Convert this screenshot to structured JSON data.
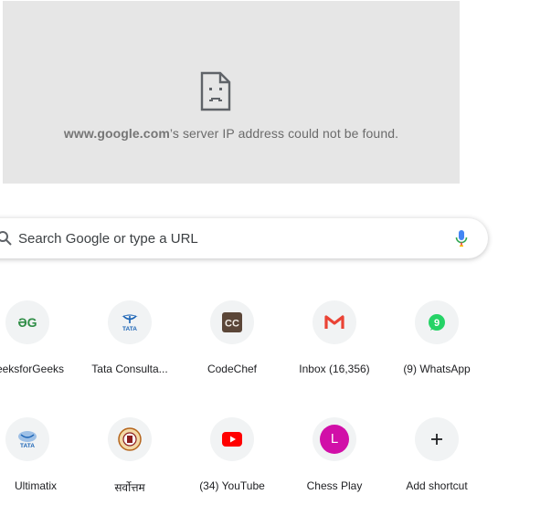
{
  "error": {
    "host": "www.google.com",
    "message": "’s server IP address could not be found."
  },
  "search": {
    "placeholder": "Search Google or type a URL"
  },
  "shortcuts": [
    {
      "label": "eeksforGeeks",
      "icon": "geeksforgeeks-icon"
    },
    {
      "label": "Tata Consulta...",
      "icon": "tata-icon"
    },
    {
      "label": "CodeChef",
      "icon": "codechef-icon"
    },
    {
      "label": "Inbox (16,356)",
      "icon": "gmail-icon"
    },
    {
      "label": "(9) WhatsApp",
      "icon": "whatsapp-icon"
    },
    {
      "label": "Ultimatix",
      "icon": "tata-icon"
    },
    {
      "label": "सर्वोत्तम",
      "icon": "emblem-icon"
    },
    {
      "label": "(34) YouTube",
      "icon": "youtube-icon"
    },
    {
      "label": "Chess Play",
      "icon": "avatar-l-icon",
      "letter": "L"
    },
    {
      "label": "Add shortcut",
      "icon": "plus-icon"
    }
  ],
  "colors": {
    "error_bg": "#e6e6e6",
    "gfg_green": "#2f8d46",
    "tata_blue": "#1a63b5",
    "codechef_brown": "#5b4638",
    "gmail_red": "#ea4335",
    "whatsapp_green": "#25d366",
    "youtube_red": "#ff0000",
    "avatar_magenta": "#d10fa8"
  }
}
